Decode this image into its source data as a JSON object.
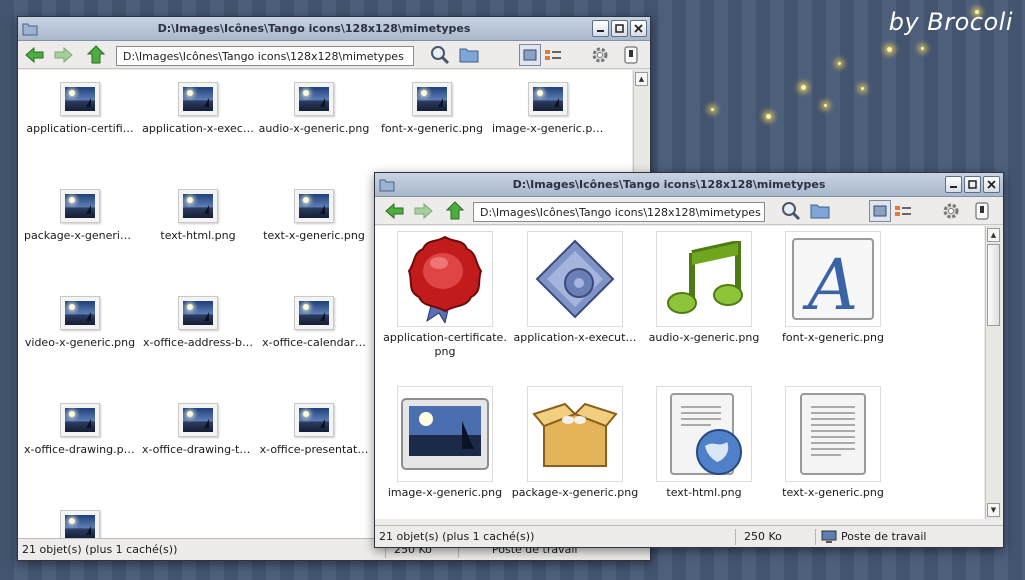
{
  "signature": "by Brocoli",
  "window_back": {
    "title": "D:\\Images\\Icônes\\Tango icons\\128x128\\mimetypes",
    "address": "D:\\Images\\Icônes\\Tango icons\\128x128\\mimetypes",
    "files": [
      "application-certifi…",
      "application-x-exec…",
      "audio-x-generic.png",
      "font-x-generic.png",
      "image-x-generic.png",
      "package-x-generic…",
      "text-html.png",
      "text-x-generic.png",
      "video-x-generic.png",
      "x-office-address-b…",
      "x-office-calendar…",
      "x-office-drawing.png",
      "x-office-drawing-te…",
      "x-office-presentat…",
      ""
    ],
    "status": {
      "count": "21 objet(s) (plus 1 caché(s))",
      "size": "250 Ko",
      "location": "Poste de travail"
    }
  },
  "window_front": {
    "title": "D:\\Images\\Icônes\\Tango icons\\128x128\\mimetypes",
    "address": "D:\\Images\\Icônes\\Tango icons\\128x128\\mimetypes",
    "files": [
      {
        "line1": "application-certificate.",
        "line2": "png",
        "icon": "certificate-icon"
      },
      {
        "line1": "application-x-execut…",
        "line2": "",
        "icon": "executable-icon"
      },
      {
        "line1": "audio-x-generic.png",
        "line2": "",
        "icon": "audio-icon"
      },
      {
        "line1": "font-x-generic.png",
        "line2": "",
        "icon": "font-icon"
      },
      {
        "line1": "image-x-generic.png",
        "line2": "",
        "icon": "image-icon"
      },
      {
        "line1": "package-x-generic.png",
        "line2": "",
        "icon": "package-icon"
      },
      {
        "line1": "text-html.png",
        "line2": "",
        "icon": "html-icon"
      },
      {
        "line1": "text-x-generic.png",
        "line2": "",
        "icon": "text-icon"
      }
    ],
    "status": {
      "count": "21 objet(s) (plus 1 caché(s))",
      "size": "250 Ko",
      "location": "Poste de travail"
    }
  },
  "colors": {
    "desktop_stripe_a": "#43546f",
    "desktop_stripe_b": "#4d5f7b",
    "titlebar": "#b8c4d6",
    "accent_green": "#3ea53a"
  }
}
